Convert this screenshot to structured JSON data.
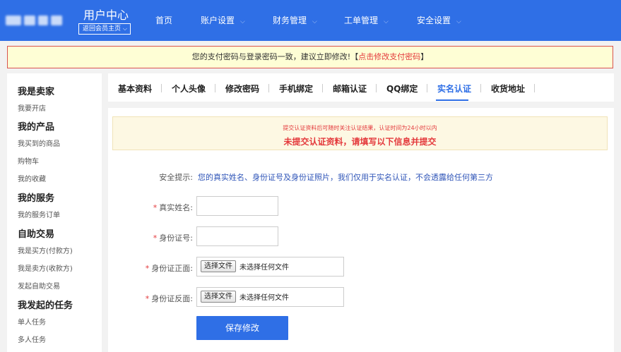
{
  "header": {
    "title": "用户中心",
    "back_label": "返回会员主页",
    "nav": [
      {
        "label": "首页"
      },
      {
        "label": "账户设置"
      },
      {
        "label": "财务管理"
      },
      {
        "label": "工单管理"
      },
      {
        "label": "安全设置"
      }
    ]
  },
  "notice": {
    "text": "您的支付密码与登录密码一致，建议立即修改!【",
    "link": "点击修改支付密码",
    "tail": "】"
  },
  "sidebar": {
    "sections": [
      {
        "title": "我是卖家",
        "items": [
          "我要开店"
        ]
      },
      {
        "title": "我的产品",
        "items": [
          "我买到的商品",
          "购物车",
          "我的收藏"
        ]
      },
      {
        "title": "我的服务",
        "items": [
          "我的服务订单"
        ]
      },
      {
        "title": "自助交易",
        "items": [
          "我是买方(付款方)",
          "我是卖方(收款方)",
          "发起自助交易"
        ]
      },
      {
        "title": "我发起的任务",
        "items": [
          "单人任务",
          "多人任务"
        ]
      }
    ]
  },
  "tabs": [
    "基本资料",
    "个人头像",
    "修改密码",
    "手机绑定",
    "邮箱认证",
    "QQ绑定",
    "实名认证",
    "收货地址"
  ],
  "active_tab": "实名认证",
  "warning": {
    "small": "提交认证资料后可随时关注认证结果，认证时间为24小时以内",
    "big": "未提交认证资料，请填写以下信息并提交"
  },
  "form": {
    "tip_label": "安全提示:",
    "tip_text": "您的真实姓名、身份证号及身份证照片，我们仅用于实名认证，不会透露给任何第三方",
    "real_name_label": "真实姓名:",
    "id_number_label": "身份证号:",
    "id_front_label": "身份证正面:",
    "id_back_label": "身份证反面:",
    "file_button": "选择文件",
    "file_none": "未选择任何文件",
    "required_mark": "*",
    "real_name_value": "",
    "id_number_value": "",
    "submit_label": "保存修改"
  },
  "colors": {
    "brand": "#2f6fe6",
    "danger": "#e4393c",
    "notice_bg": "#fefed5"
  }
}
